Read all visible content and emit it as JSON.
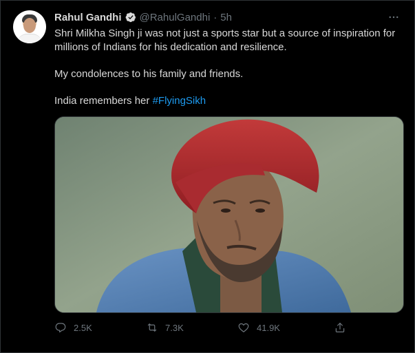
{
  "tweet": {
    "author_name": "Rahul Gandhi",
    "handle": "@RahulGandhi",
    "separator": "·",
    "time": "5h",
    "paragraphs": [
      "Shri Milkha Singh ji was not just a sports star but a source of inspiration for millions of Indians for his dedication and resilience.",
      "My condolences to his family and friends."
    ],
    "last_line_prefix": "India remembers her ",
    "hashtag": "#FlyingSikh"
  },
  "actions": {
    "reply_count": "2.5K",
    "retweet_count": "7.3K",
    "like_count": "41.9K"
  },
  "icons": {
    "verified": "verified-badge-icon",
    "more": "more-dots-icon",
    "reply": "reply-icon",
    "retweet": "retweet-icon",
    "like": "heart-icon",
    "share": "share-icon"
  },
  "colors": {
    "background": "#000000",
    "text": "#d9d9d9",
    "muted": "#6e767d",
    "accent": "#1d9bf0",
    "turban": "#b3262b",
    "shirt": "#4f79a8"
  }
}
